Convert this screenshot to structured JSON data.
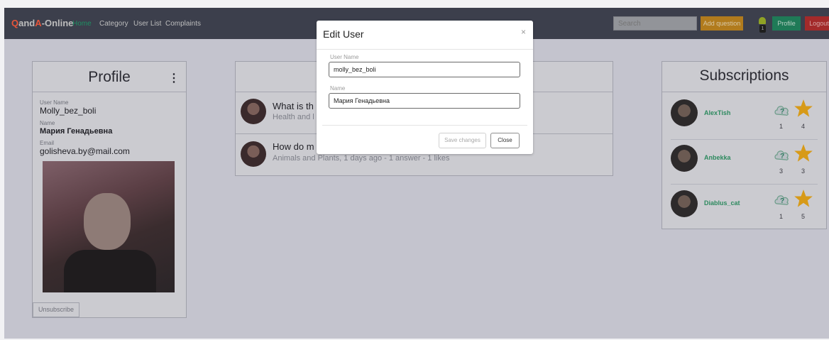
{
  "navbar": {
    "brand_q": "Q",
    "brand_and": "and",
    "brand_a": "A",
    "brand_rest": "-Online",
    "links": [
      "Home",
      "Category",
      "User List",
      "Complaints"
    ],
    "search_placeholder": "Search",
    "add_question_label": "Add question",
    "notification_count": "1",
    "profile_label": "Profile",
    "logout_label": "Logout"
  },
  "profile": {
    "title": "Profile",
    "menu_icon": "⋮",
    "username_label": "User Name",
    "username": "Molly_bez_boli",
    "name_label": "Name",
    "name": "Мария Генадьевна",
    "email_label": "Email",
    "email": "golisheva.by@mail.com",
    "unsubscribe_label": "Unsubscribe"
  },
  "questions": [
    {
      "title": "What is th",
      "meta": "Health and l"
    },
    {
      "title": "How do m",
      "meta": "Animals and Plants, 1 days ago - 1 answer - 1 likes"
    }
  ],
  "subscriptions": {
    "title": "Subscriptions",
    "items": [
      {
        "name": "AlexTish",
        "questions": "1",
        "rating": "4"
      },
      {
        "name": "Anbekka",
        "questions": "3",
        "rating": "3"
      },
      {
        "name": "Diablus_cat",
        "questions": "1",
        "rating": "5"
      }
    ]
  },
  "modal": {
    "title": "Edit User",
    "close_icon": "×",
    "username_label": "User Name",
    "username_value": "molly_bez_boli",
    "name_label": "Name",
    "name_value": "Мария Генадьевна",
    "save_label": "Save changes",
    "close_label": "Close"
  },
  "colors": {
    "backdrop": "#c4c4ce",
    "navbar": "#3c3f4c",
    "brand_accent": "#e6553a",
    "link_active": "#1f8f63",
    "add_button": "#b17b1d",
    "profile_button": "#1f7a57",
    "logout_button": "#a32a2a",
    "star": "#d79a18"
  }
}
